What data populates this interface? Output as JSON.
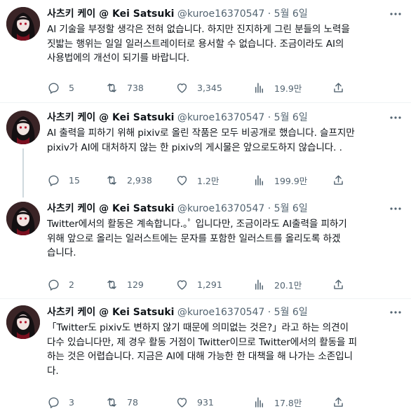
{
  "tweets": [
    {
      "name": "사츠키 케이 @ Kei Satsuki",
      "handle": "@kuroe16370547",
      "time": "· 5월 6일",
      "lines": [
        "AI 기술을 부정할 생각은 전혀 없습니다. 하지만 진지하게 그린 분들의 노력을",
        "짓밟는 행위는 일일 일러스트레이터로 용서할 수 없습니다. 조금이라도 AI의",
        "사용법에의 개선이 되기를 바랍니다."
      ],
      "replies": "5",
      "retweets": "738",
      "likes": "3,345",
      "views": "19.9만"
    },
    {
      "name": "사츠키 케이 @ Kei Satsuki",
      "handle": "@kuroe16370547",
      "time": "· 5월 6일",
      "lines": [
        "AI 출력을 피하기 위해 pixiv로 올린 작품은 모두 비공개로 했습니다. 슬프지만",
        "pixiv가 AI에 대처하지 않는 한 pixiv의 게시물은 앞으로도하지 않습니다. ."
      ],
      "replies": "15",
      "retweets": "2,938",
      "likes": "1.2만",
      "views": "199.9만"
    },
    {
      "name": "사츠키 케이 @ Kei Satsuki",
      "handle": "@kuroe16370547",
      "time": "· 5월 6일",
      "lines": [
        "Twitter에서의 활동은 계속합니다.｡ﾟ 입니다만, 조금이라도 AI출력을 피하기",
        "위해 앞으로 올리는 일러스트에는 문자를 포함한 일러스트를 올리도록 하겠",
        "습니다."
      ],
      "replies": "2",
      "retweets": "129",
      "likes": "1,291",
      "views": "20.1만"
    },
    {
      "name": "사츠키 케이 @ Kei Satsuki",
      "handle": "@kuroe16370547",
      "time": "· 5월 6일",
      "lines": [
        "「Twitter도 pixiv도 변하지 않기 때문에 의미없는 것은?」라고 하는 의견이",
        "다수 있습니다만, 제 경우 활동 거점이 Twitter이므로 Twitter에서의 활동을 피",
        "하는 것은 어렵습니다. 지금은 AI에 대해 가능한 한 대책을 해 나가는 소존입니",
        "다."
      ],
      "replies": "3",
      "retweets": "78",
      "likes": "931",
      "views": "17.8만"
    }
  ],
  "icons": {
    "reply": "reply-icon",
    "retweet": "retweet-icon",
    "like": "heart-icon",
    "views": "views-icon",
    "share": "share-icon",
    "more": "more-icon"
  },
  "colors": {
    "text": "#0f1419",
    "secondary": "#536471",
    "divider": "#eff3f4",
    "thread_line": "#cfd9de"
  }
}
